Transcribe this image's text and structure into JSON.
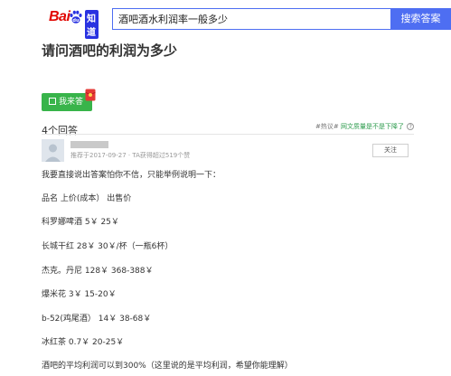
{
  "header": {
    "logo_text_left": "Bai",
    "logo_text_right": "知道",
    "logo_icon": "paw-icon",
    "search_value": "酒吧酒水利润率一般多少",
    "search_button_label": "搜索答案",
    "brand_color": "#e10601",
    "accent_color": "#4e6ef2"
  },
  "question": {
    "title": "请问酒吧的利润为多少"
  },
  "actions": {
    "answer_button_label": "我来答",
    "answer_icon": "pencil-icon",
    "redpacket_icon": "red-packet-icon",
    "button_color": "#38b44a"
  },
  "answers": {
    "count_label": "4个回答",
    "report_prefix": "#热议#",
    "report_link": "网文质量是不是下降了",
    "report_icon": "question-icon"
  },
  "answer": {
    "meta": "推荐于2017-09-27 · TA获得超过519个赞",
    "follow_label": "关注",
    "paragraphs": [
      "我要直接说出答案怕你不信，只能举例说明一下：",
      "品名 上价(成本） 出售价",
      "科罗娜啤酒 5￥ 25￥",
      "长城干红 28￥ 30￥/杯（一瓶6杯）",
      "杰克。丹尼 128￥ 368-388￥",
      "爆米花 3￥ 15-20￥",
      "b-52(鸡尾酒） 14￥ 38-68￥",
      "冰红茶 0.7￥ 20-25￥",
      "酒吧的平均利润可以到300%（这里说的是平均利润，希望你能理解）"
    ]
  }
}
